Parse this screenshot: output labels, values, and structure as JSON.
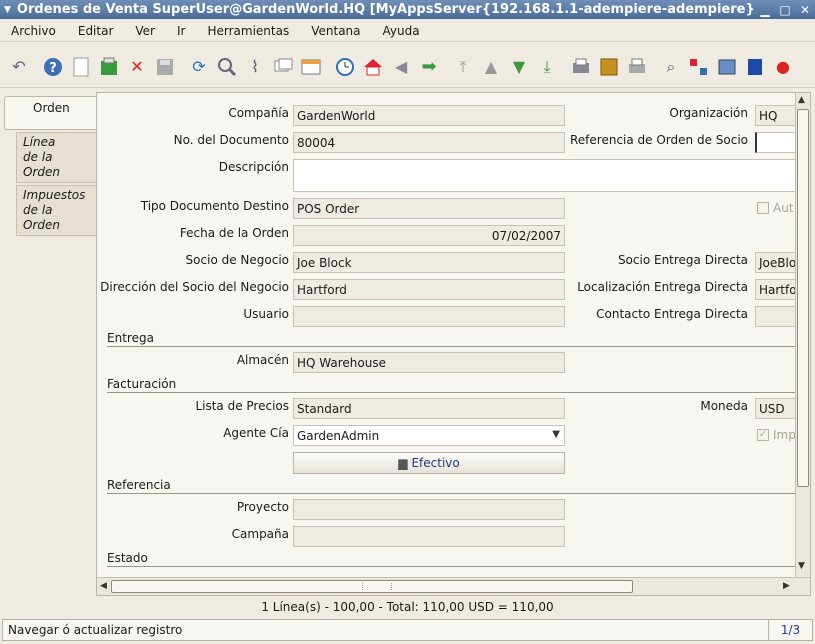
{
  "window": {
    "title": "Órdenes de Venta  SuperUser@GardenWorld.HQ [MyAppsServer{192.168.1.1-adempiere-adempiere}]"
  },
  "menu": [
    "Archivo",
    "Editar",
    "Ver",
    "Ir",
    "Herramientas",
    "Ventana",
    "Ayuda"
  ],
  "tabs": {
    "main": "Orden",
    "lines": "Línea de la Orden",
    "lines_1": "Línea",
    "lines_2": "de la Orden",
    "taxes_1": "Impuestos",
    "taxes_2": "de la Orden"
  },
  "form": {
    "company_label": "Compañía",
    "company": "GardenWorld",
    "org_label": "Organización",
    "org": "HQ",
    "docno_label": "No. del Documento",
    "docno": "80004",
    "bporderref_label": "Referencia de Orden de Socio",
    "bporderref": "",
    "description_label": "Descripción",
    "description": "",
    "doctype_label": "Tipo Documento Destino",
    "doctype": "POS Order",
    "auto_label": "Aut",
    "dateordered_label": "Fecha de la Orden",
    "dateordered": "07/02/2007",
    "bpartner_label": "Socio de Negocio",
    "bpartner": "Joe Block",
    "dropship_bp_label": "Socio Entrega Directa",
    "dropship_bp": "JoeBlo",
    "bplocation_label": "Dirección del Socio del Negocio",
    "bplocation": "Hartford",
    "dropship_loc_label": "Localización Entrega Directa",
    "dropship_loc": "Hartfo",
    "user_label": "Usuario",
    "user": "",
    "dropship_contact_label": "Contacto Entrega Directa",
    "dropship_contact": "",
    "section_delivery": "Entrega",
    "warehouse_label": "Almacén",
    "warehouse": "HQ Warehouse",
    "section_invoicing": "Facturación",
    "pricelist_label": "Lista de Precios",
    "pricelist": "Standard",
    "currency_label": "Moneda",
    "currency": "USD",
    "salesrep_label": "Agente Cía",
    "salesrep": "GardenAdmin",
    "taxinc_label": "Imp",
    "payment_button": "Efectivo",
    "section_reference": "Referencia",
    "project_label": "Proyecto",
    "project": "",
    "campaign_label": "Campaña",
    "campaign": "",
    "section_status": "Estado"
  },
  "summary": "1 Línea(s) - 100,00 -  Total: 110,00  USD =  110,00",
  "status": {
    "message": "Navegar ó actualizar registro",
    "page": "1/3"
  },
  "icons": [
    "undo-icon",
    "help-icon",
    "new-icon",
    "copy-icon",
    "delete-icon",
    "save-icon",
    "refresh-icon",
    "find-icon",
    "attachment-icon",
    "chat-icon",
    "grid-toggle-icon",
    "history-icon",
    "home-icon",
    "previous-icon",
    "next-icon",
    "first-icon",
    "parent-icon",
    "detail-icon",
    "last-icon",
    "report-icon",
    "archive-icon",
    "print-icon",
    "zoom-across-icon",
    "workflow-icon",
    "requests-icon",
    "product-info-icon",
    "exit-icon"
  ]
}
